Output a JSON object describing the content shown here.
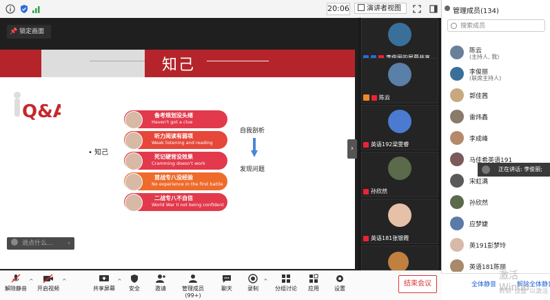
{
  "topbar": {
    "time": "20:06",
    "view_label": "演讲者视图"
  },
  "stage": {
    "lock_label": "锁定画面",
    "slide": {
      "title": "知己",
      "qa_text": "Q&A",
      "bullet": "• 知己",
      "items": [
        {
          "zh": "备考规划没头绪",
          "en": "Haven't got a clue",
          "color": "#e2394c"
        },
        {
          "zh": "听力阅读有弱项",
          "en": "Weak listening and reading",
          "color": "#e6473a"
        },
        {
          "zh": "死记硬背没效果",
          "en": "Cramming doesn't work",
          "color": "#e2394c"
        },
        {
          "zh": "首战专八没经验",
          "en": "No experience in the first battle",
          "color": "#ee6b2c"
        },
        {
          "zh": "二战专八不自信",
          "en": "World War II not being confident",
          "color": "#e2394c"
        }
      ],
      "right_top": "自我剖析",
      "right_bottom": "发现问题"
    },
    "chat_placeholder": "说点什么...",
    "collapse_glyph": "›"
  },
  "videos": [
    {
      "name": "李俊丽的屏幕共享",
      "avatar_color": "#3a6f9a"
    },
    {
      "name": "陈云",
      "avatar_color": "#5a7fa8"
    },
    {
      "name": "英语192梁雯睿",
      "avatar_color": "#4a7bd0"
    },
    {
      "name": "孙欣然",
      "avatar_color": "#5a6a4a"
    },
    {
      "name": "英语181张银霞",
      "avatar_color": "#e6c1a8"
    },
    {
      "name": "",
      "avatar_color": "#c08040"
    }
  ],
  "panel": {
    "title": "管理成员(134)",
    "search_placeholder": "搜索成员",
    "members": [
      {
        "name": "陈云",
        "sub": "(主持人, 我)"
      },
      {
        "name": "李俊丽",
        "sub": "(联席主持人)"
      },
      {
        "name": "郭佳茜",
        "sub": ""
      },
      {
        "name": "雷炜鑫",
        "sub": ""
      },
      {
        "name": "李成峰",
        "sub": ""
      },
      {
        "name": "马佳希英语191",
        "sub": ""
      },
      {
        "name": "宋虹满",
        "sub": ""
      },
      {
        "name": "孙欣然",
        "sub": ""
      },
      {
        "name": "应梦婕",
        "sub": ""
      },
      {
        "name": "英191彭梦玲",
        "sub": ""
      },
      {
        "name": "英语181陈丽",
        "sub": ""
      }
    ],
    "speaking": "正在讲话: 李俊丽;",
    "mute_all": "全体静音",
    "unmute_all": "解除全体静音"
  },
  "watermark": {
    "line1": "激活 Windo",
    "line2": "转到\"设置\"以激活"
  },
  "toolbar": {
    "buttons": [
      {
        "label": "解除静音",
        "icon": "mic-muted-icon"
      },
      {
        "label": "开启视频",
        "icon": "camera-off-icon"
      },
      {
        "label": "共享屏幕",
        "icon": "screen-share-icon"
      },
      {
        "label": "安全",
        "icon": "shield-icon"
      },
      {
        "label": "邀请",
        "icon": "invite-icon"
      },
      {
        "label": "管理成员(99+)",
        "icon": "members-icon"
      },
      {
        "label": "聊天",
        "icon": "chat-icon"
      },
      {
        "label": "录制",
        "icon": "record-icon"
      },
      {
        "label": "分组讨论",
        "icon": "breakout-icon"
      },
      {
        "label": "应用",
        "icon": "apps-icon"
      },
      {
        "label": "设置",
        "icon": "gear-icon"
      }
    ],
    "end_label": "结束会议"
  }
}
